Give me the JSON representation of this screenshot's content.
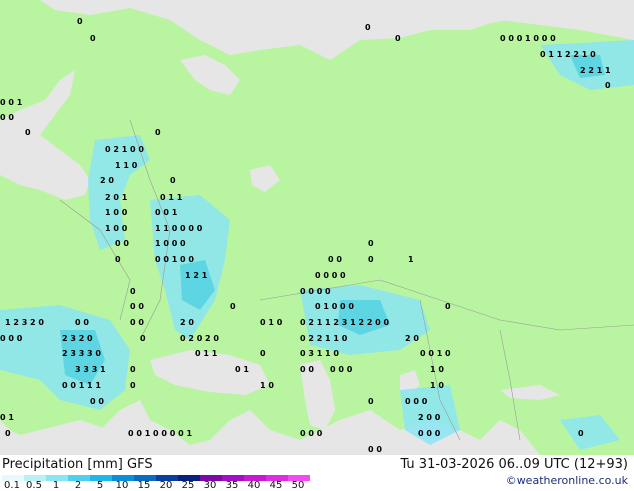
{
  "map": {
    "land_color": "#b9f5a0",
    "sea_color": "#e6e6e6",
    "border_color": "#9a9a9a",
    "grid_values": [
      {
        "text": "0"
      },
      {
        "text": "0"
      },
      {
        "text": "0"
      },
      {
        "text": "0"
      },
      {
        "text": "0 0 0 1 0 0 0"
      },
      {
        "text": "0 1 1 2 2 1 0"
      },
      {
        "text": "2 2 1 1"
      },
      {
        "text": "0"
      },
      {
        "text": "0 0 1"
      },
      {
        "text": "0 0"
      },
      {
        "text": "0"
      },
      {
        "text": "0"
      },
      {
        "text": "0 2 1 0 0"
      },
      {
        "text": "1 1 0"
      },
      {
        "text": "2 0"
      },
      {
        "text": "2 0 1"
      },
      {
        "text": "0"
      },
      {
        "text": "1 0 0"
      },
      {
        "text": "0 1 1"
      },
      {
        "text": "1 0 0"
      },
      {
        "text": "0 0 1"
      },
      {
        "text": "0 0"
      },
      {
        "text": "1 1 0 0 0 0"
      },
      {
        "text": "1 0 0 0"
      },
      {
        "text": "0"
      },
      {
        "text": "0 0 1 0 0"
      },
      {
        "text": "1 2 1"
      },
      {
        "text": "0"
      },
      {
        "text": "0 0"
      },
      {
        "text": "0"
      },
      {
        "text": "1"
      },
      {
        "text": "0 0 0 0"
      },
      {
        "text": "0 0 0 0"
      },
      {
        "text": "0 1 0 0 0"
      },
      {
        "text": "0"
      },
      {
        "text": "0 0"
      },
      {
        "text": "1 2 3 2 0"
      },
      {
        "text": "0 0"
      },
      {
        "text": "0 0"
      },
      {
        "text": "0"
      },
      {
        "text": "2 0"
      },
      {
        "text": "0 1 0"
      },
      {
        "text": "0 2 1 1 2 3 1 2 2 0 0"
      },
      {
        "text": "0"
      },
      {
        "text": "0 0 0"
      },
      {
        "text": "2 3 2 0"
      },
      {
        "text": "0"
      },
      {
        "text": "0 2 0 2 0"
      },
      {
        "text": "0 2 2 1 1 0"
      },
      {
        "text": "2 0"
      },
      {
        "text": "2 3 3 3 0"
      },
      {
        "text": "0 1 1"
      },
      {
        "text": "0"
      },
      {
        "text": "0 3 1 1 0"
      },
      {
        "text": "0 0 1 0"
      },
      {
        "text": "3 3 3 1"
      },
      {
        "text": "0 1"
      },
      {
        "text": "0 0"
      },
      {
        "text": "1 0"
      },
      {
        "text": "0"
      },
      {
        "text": "0 0 0"
      },
      {
        "text": "0 0 1 1 1"
      },
      {
        "text": "1 0"
      },
      {
        "text": "0"
      },
      {
        "text": "1 0"
      },
      {
        "text": "0 0"
      },
      {
        "text": "0"
      },
      {
        "text": "0 0 0"
      },
      {
        "text": "0 1"
      },
      {
        "text": "2 0 0"
      },
      {
        "text": "0 0 1 0 0 0 0 1"
      },
      {
        "text": "0 0 0"
      },
      {
        "text": "0 0 0"
      },
      {
        "text": "0"
      },
      {
        "text": "0"
      },
      {
        "text": "0 0"
      }
    ]
  },
  "footer": {
    "title": "Precipitation [mm] GFS",
    "datetime": "Tu 31-03-2026 06..09 UTC (12+93)",
    "copyright": "©weatheronline.co.uk",
    "legend": {
      "labels": [
        "0.1",
        "0.5",
        "1",
        "2",
        "5",
        "10",
        "15",
        "20",
        "25",
        "30",
        "35",
        "40",
        "45",
        "50"
      ],
      "colors": [
        "#e6fafc",
        "#b9f1f7",
        "#8be4f3",
        "#4fd0ee",
        "#1fb6e8",
        "#0a8fd8",
        "#0b6ac2",
        "#0a3f9d",
        "#07227a",
        "#7a0aa3",
        "#a30fc6",
        "#c818d2",
        "#de2cdf",
        "#f04cf0"
      ]
    }
  }
}
